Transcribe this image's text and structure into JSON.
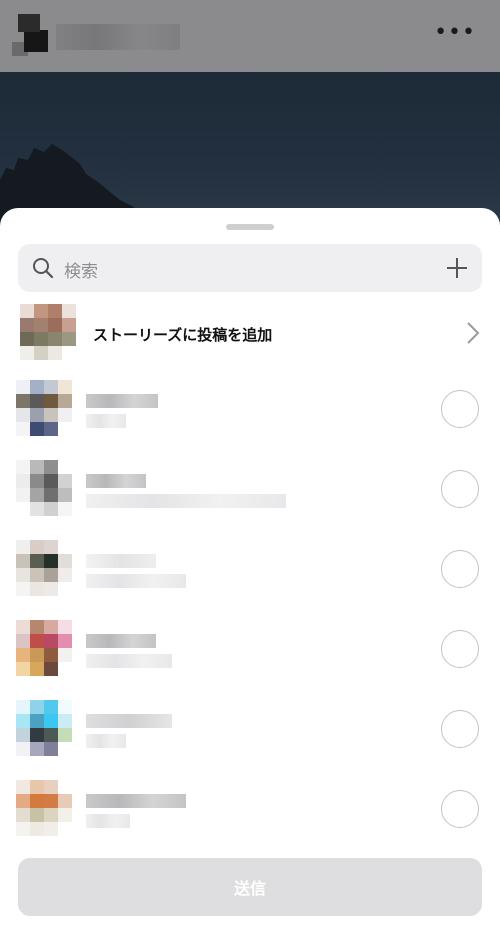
{
  "search": {
    "placeholder": "検索"
  },
  "story": {
    "label": "ストーリーズに投稿を追加"
  },
  "contacts_count_visible": 6,
  "send": {
    "label": "送信"
  },
  "colors": {
    "sheet_bg": "#ffffff",
    "search_bg": "#efeff1",
    "send_disabled_bg": "#dedee0",
    "radio_border": "#c4c4c7"
  },
  "icons": [
    "more-icon",
    "search-icon",
    "plus-icon",
    "chevron-right-icon"
  ]
}
